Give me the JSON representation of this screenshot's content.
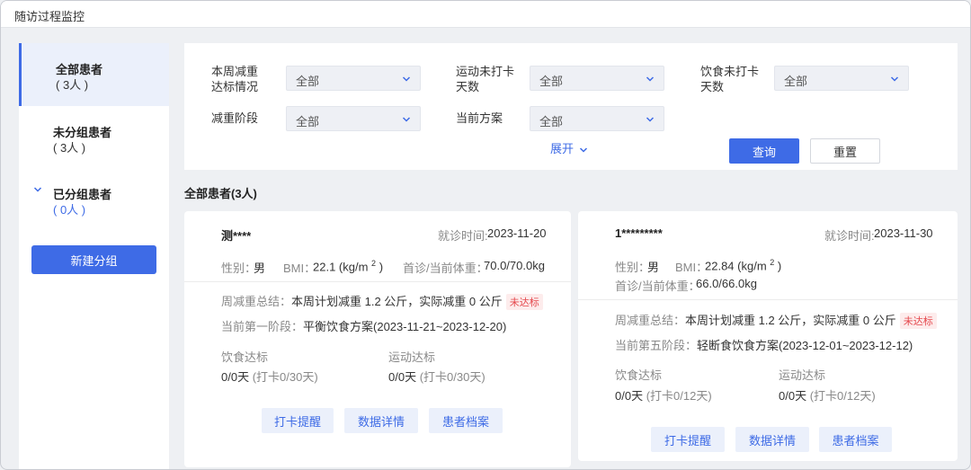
{
  "window": {
    "title": "随访过程监控"
  },
  "sidebar": {
    "items": [
      {
        "name": "全部患者",
        "count": "( 3人 )"
      },
      {
        "name": "未分组患者",
        "count": "( 3人 )"
      },
      {
        "name": "已分组患者",
        "count": "( 0人 )"
      }
    ],
    "new_group_label": "新建分组"
  },
  "filters": {
    "weekly_loss": {
      "label_line1": "本周减重",
      "label_line2": "达标情况",
      "value": "全部"
    },
    "exercise_days": {
      "label_line1": "运动未打卡",
      "label_line2": "天数",
      "value": "全部"
    },
    "diet_days": {
      "label_line1": "饮食未打卡",
      "label_line2": "天数",
      "value": "全部"
    },
    "phase": {
      "label": "减重阶段",
      "value": "全部"
    },
    "plan": {
      "label": "当前方案",
      "value": "全部"
    },
    "expand_label": "展开",
    "query_label": "查询",
    "reset_label": "重置"
  },
  "list_title": "全部患者(3人)",
  "cards": [
    {
      "name": "测****",
      "visit_label": "就诊时间:",
      "visit_date": "2023-11-20",
      "gender_label": "性别：",
      "gender": "男",
      "bmi_label": "BMI：",
      "bmi_value": "22.1 (kg/m",
      "bmi_exp": "2",
      "bmi_close": ")",
      "weight_label": "首诊/当前体重：",
      "weight": "70.0/70.0kg",
      "summary_label": "周减重总结：",
      "summary_text": "本周计划减重 1.2 公斤，实际减重  0  公斤",
      "status_tag": "未达标",
      "phase_label": "当前第一阶段：",
      "phase_text": "平衡饮食方案(2023-11-21~2023-12-20)",
      "diet_label": "饮食达标",
      "diet_value": "0/0天",
      "diet_checkin": "(打卡0/30天)",
      "exercise_label": "运动达标",
      "exercise_value": "0/0天",
      "exercise_checkin": "(打卡0/30天)",
      "btn_remind": "打卡提醒",
      "btn_data": "数据详情",
      "btn_profile": "患者档案"
    },
    {
      "name": "1*********",
      "visit_label": "就诊时间:",
      "visit_date": "2023-11-30",
      "gender_label": "性别：",
      "gender": "男",
      "bmi_label": "BMI：",
      "bmi_value": "22.84 (kg/m",
      "bmi_exp": "2",
      "bmi_close": ")",
      "weight_label": "首诊/当前体重：",
      "weight": "66.0/66.0kg",
      "summary_label": "周减重总结：",
      "summary_text": "本周计划减重 1.2 公斤，实际减重  0  公斤",
      "status_tag": "未达标",
      "phase_label": "当前第五阶段：",
      "phase_text": "轻断食饮食方案(2023-12-01~2023-12-12)",
      "diet_label": "饮食达标",
      "diet_value": "0/0天",
      "diet_checkin": "(打卡0/12天)",
      "exercise_label": "运动达标",
      "exercise_value": "0/0天",
      "exercise_checkin": "(打卡0/12天)",
      "btn_remind": "打卡提醒",
      "btn_data": "数据详情",
      "btn_profile": "患者档案"
    }
  ],
  "colors": {
    "accent": "#3e6be6",
    "danger": "#e5484d",
    "background": "#eef0f3"
  }
}
